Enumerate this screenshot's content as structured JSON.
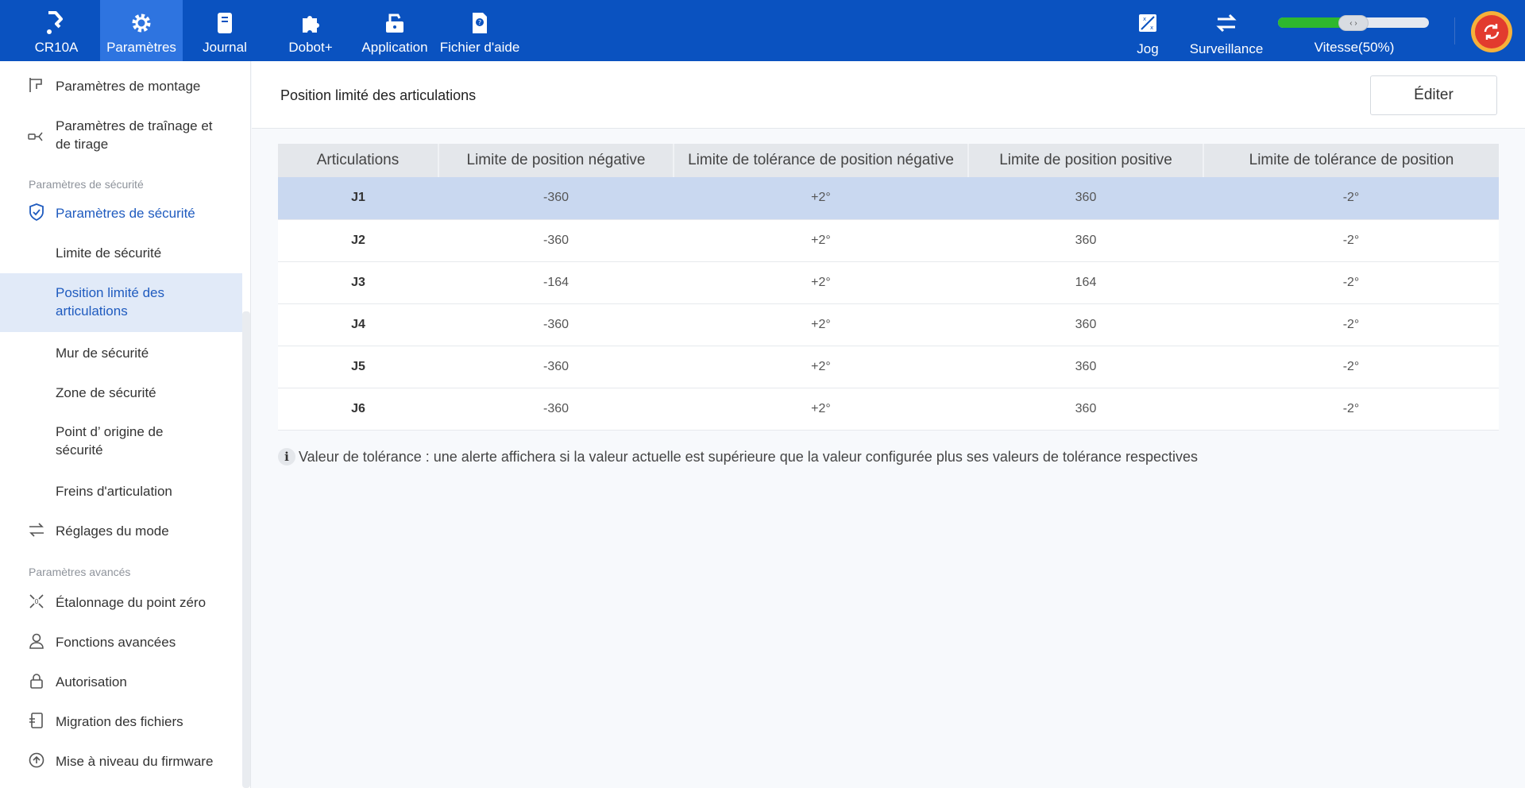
{
  "nav": {
    "items": [
      {
        "id": "robot",
        "label": "CR10A"
      },
      {
        "id": "params",
        "label": "Paramètres"
      },
      {
        "id": "journal",
        "label": "Journal"
      },
      {
        "id": "dobot",
        "label": "Dobot+"
      },
      {
        "id": "app",
        "label": "Application"
      },
      {
        "id": "help",
        "label": "Fichier d'aide"
      }
    ],
    "jog": "Jog",
    "surveillance": "Surveillance",
    "speed_label": "Vitesse(50%)",
    "speed_value": 0.5
  },
  "sidebar": {
    "items": [
      {
        "label": "Paramètres de montage"
      },
      {
        "label": "Paramètres de traînage et de tirage"
      },
      {
        "label": "Paramètres de sécurité"
      },
      {
        "label": "Limite de sécurité"
      },
      {
        "label": "Position limité des articulations"
      },
      {
        "label": "Mur de sécurité"
      },
      {
        "label": "Zone de sécurité"
      },
      {
        "label": "Point d’ origine de sécurité"
      },
      {
        "label": "Freins d'articulation"
      },
      {
        "label": "Réglages du mode"
      },
      {
        "label": "Étalonnage du point zéro"
      },
      {
        "label": "Fonctions avancées"
      },
      {
        "label": "Autorisation"
      },
      {
        "label": "Migration des fichiers"
      },
      {
        "label": "Mise à niveau du firmware"
      }
    ],
    "section_safety": "Paramètres de sécurité",
    "section_advanced": "Paramètres avancés"
  },
  "main": {
    "title": "Position limité des articulations",
    "edit_label": "Éditer",
    "columns": [
      "Articulations",
      "Limite de position négative",
      "Limite de tolérance de position négative",
      "Limite de position positive",
      "Limite de tolérance de position"
    ],
    "rows": [
      [
        "J1",
        "-360",
        "+2°",
        "360",
        "-2°"
      ],
      [
        "J2",
        "-360",
        "+2°",
        "360",
        "-2°"
      ],
      [
        "J3",
        "-164",
        "+2°",
        "164",
        "-2°"
      ],
      [
        "J4",
        "-360",
        "+2°",
        "360",
        "-2°"
      ],
      [
        "J5",
        "-360",
        "+2°",
        "360",
        "-2°"
      ],
      [
        "J6",
        "-360",
        "+2°",
        "360",
        "-2°"
      ]
    ],
    "note_icon": "i",
    "note": "Valeur de tolérance : une alerte affichera si la valeur actuelle est supérieure que la valeur configurée plus ses valeurs de tolérance respectives"
  },
  "colors": {
    "topbar": "#0a52c0",
    "active_nav": "#2e74e0",
    "accent": "#1f5bbf",
    "selected_row": "#c9d8f0",
    "speed_fill": "#2eb82e"
  }
}
